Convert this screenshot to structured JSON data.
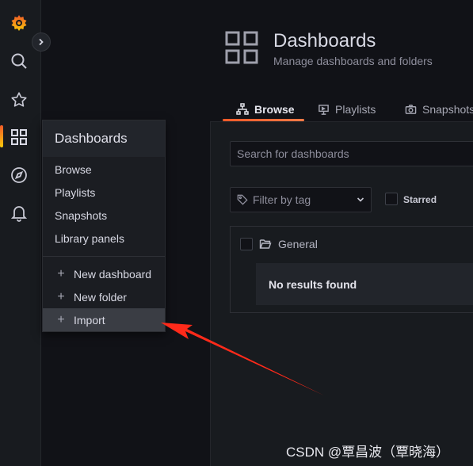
{
  "header": {
    "title": "Dashboards",
    "subtitle": "Manage dashboards and folders",
    "icon": "dashboards-grid-icon"
  },
  "tabs": [
    {
      "label": "Browse",
      "icon": "sitemap-icon",
      "active": true
    },
    {
      "label": "Playlists",
      "icon": "presentation-icon",
      "active": false
    },
    {
      "label": "Snapshots",
      "icon": "camera-icon",
      "active": false
    }
  ],
  "search": {
    "placeholder": "Search for dashboards"
  },
  "filter": {
    "placeholder": "Filter by tag"
  },
  "starred": {
    "label": "Starred"
  },
  "folder": {
    "name": "General"
  },
  "results": {
    "empty": "No results found"
  },
  "menu": {
    "title": "Dashboards",
    "items": [
      "Browse",
      "Playlists",
      "Snapshots",
      "Library panels"
    ],
    "actions": [
      "New dashboard",
      "New folder",
      "Import"
    ],
    "highlighted": "Import"
  },
  "sidebar": {
    "icons": [
      "grafana-logo",
      "search-icon",
      "star-icon",
      "apps-icon",
      "explore-icon",
      "alerting-bell-icon"
    ]
  },
  "colors": {
    "accent": "#f05a28",
    "annotation_arrow": "#ff2a1a"
  },
  "watermark": "CSDN @覃昌波（覃晓海）"
}
